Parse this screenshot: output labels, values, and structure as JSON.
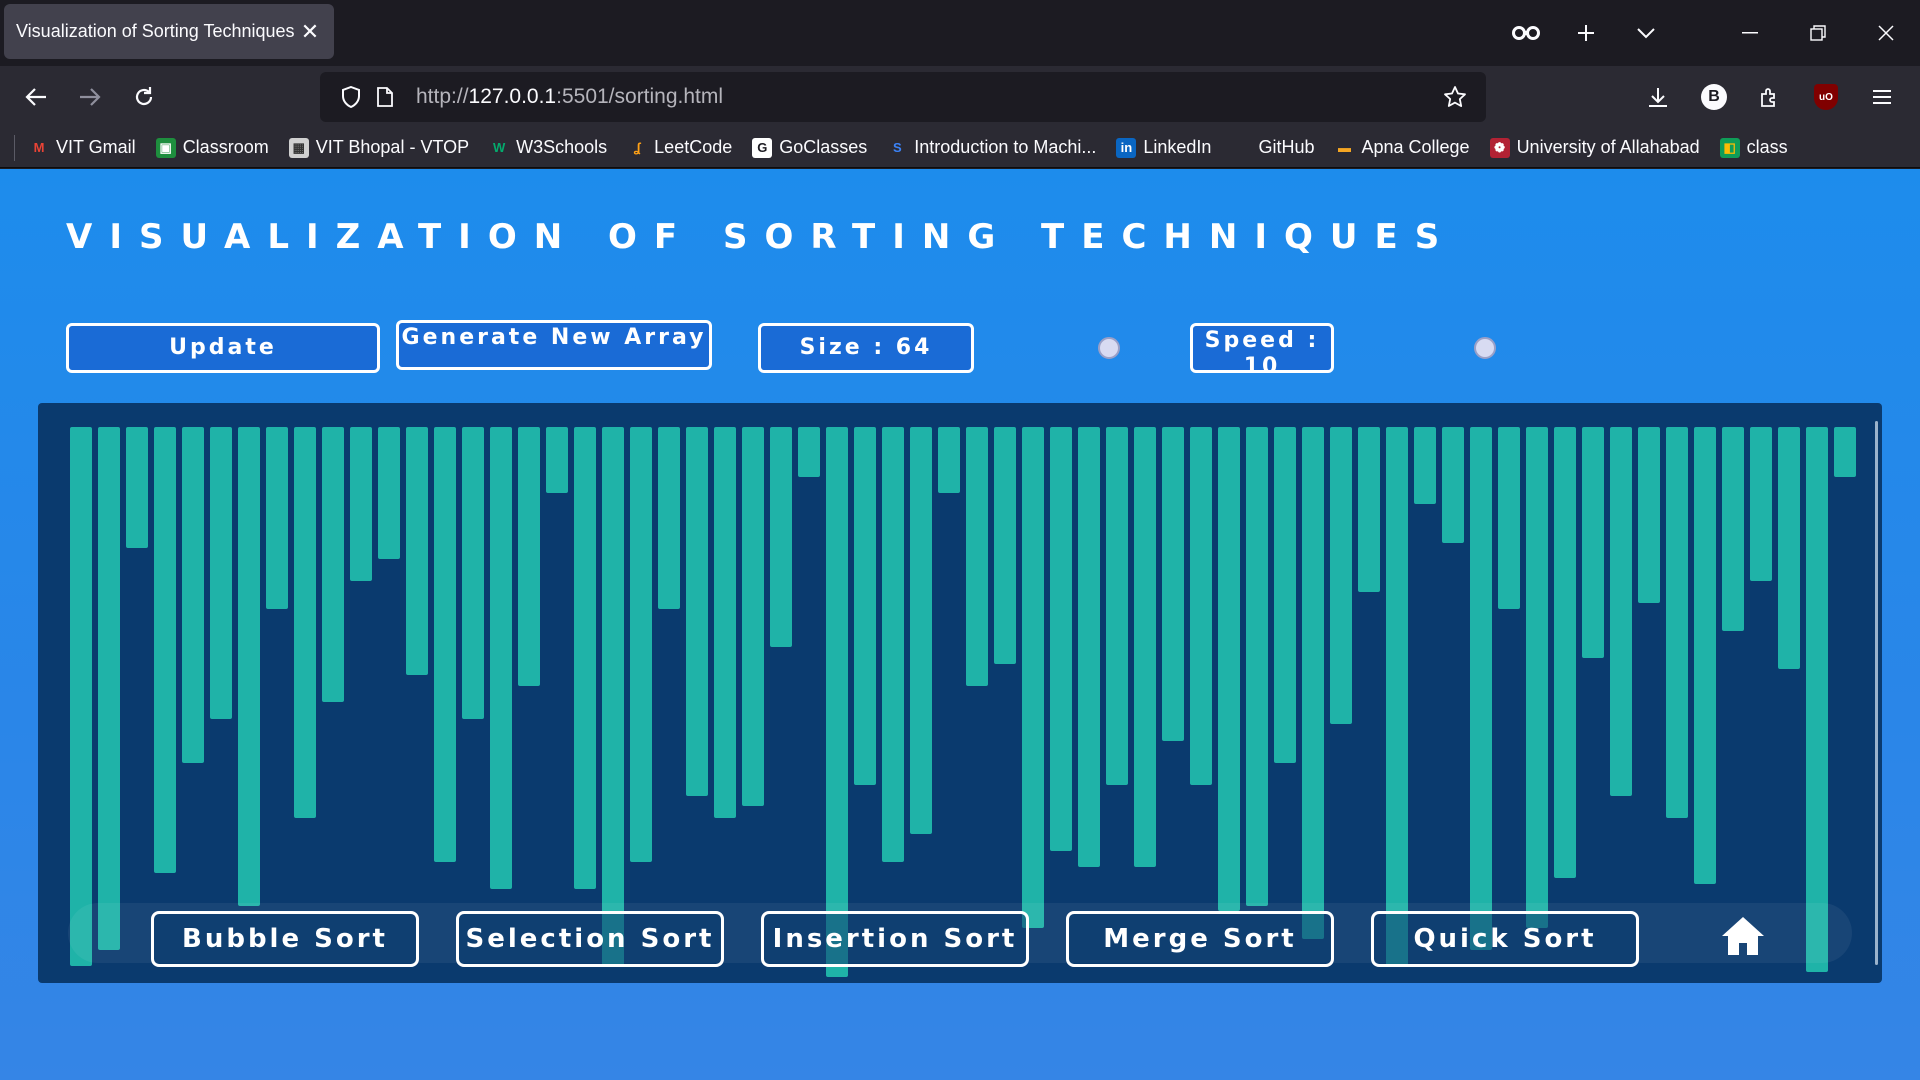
{
  "browser": {
    "tab_title": "Visualization of Sorting Techniques",
    "tab_close": "✕",
    "url_prefix": "http://",
    "url_host": "127.0.0.1",
    "url_rest": ":5501/sorting.html",
    "profile_initial": "B",
    "ublock_label": "uO"
  },
  "bookmarks": [
    {
      "label": "VIT Gmail",
      "icon_glyph": "M",
      "icon_color": "#ea4335",
      "icon_bg": "transparent"
    },
    {
      "label": "Classroom",
      "icon_glyph": "▣",
      "icon_color": "#ffffff",
      "icon_bg": "#1e8e3e"
    },
    {
      "label": "VIT Bhopal - VTOP",
      "icon_glyph": "▦",
      "icon_color": "#333333",
      "icon_bg": "#d0d0d0"
    },
    {
      "label": "W3Schools",
      "icon_glyph": "W",
      "icon_color": "#04aa6d",
      "icon_bg": "transparent"
    },
    {
      "label": "LeetCode",
      "icon_glyph": "ʆ",
      "icon_color": "#ffa116",
      "icon_bg": "transparent"
    },
    {
      "label": "GoClasses",
      "icon_glyph": "G",
      "icon_color": "#1c1b22",
      "icon_bg": "#ffffff"
    },
    {
      "label": "Introduction to Machi...",
      "icon_glyph": "S",
      "icon_color": "#3b82f6",
      "icon_bg": "transparent"
    },
    {
      "label": "LinkedIn",
      "icon_glyph": "in",
      "icon_color": "#ffffff",
      "icon_bg": "#0a66c2"
    },
    {
      "label": "GitHub",
      "icon_glyph": "",
      "icon_color": "#2b2a33",
      "icon_bg": "transparent"
    },
    {
      "label": "Apna College",
      "icon_glyph": "▬",
      "icon_color": "#f5a623",
      "icon_bg": "transparent"
    },
    {
      "label": "University of Allahabad",
      "icon_glyph": "❁",
      "icon_color": "#ffffff",
      "icon_bg": "#b22234"
    },
    {
      "label": "class",
      "icon_glyph": "◧",
      "icon_color": "#fbbc04",
      "icon_bg": "#0f9d58"
    }
  ],
  "page": {
    "title": "VISUALIZATION OF SORTING TECHNIQUES",
    "controls": {
      "update": "Update",
      "generate": "Generate New Array",
      "size": "Size : 64",
      "speed": "Speed : 10"
    },
    "sort_buttons": [
      "Bubble Sort",
      "Selection Sort",
      "Insertion Sort",
      "Merge Sort",
      "Quick Sort"
    ],
    "bar_color": "#1fb3a8",
    "bar_heights_relative": [
      0.98,
      0.95,
      0.22,
      0.81,
      0.61,
      0.53,
      0.87,
      0.33,
      0.71,
      0.5,
      0.28,
      0.24,
      0.45,
      0.79,
      0.53,
      0.84,
      0.47,
      0.12,
      0.84,
      0.98,
      0.79,
      0.33,
      0.67,
      0.71,
      0.69,
      0.4,
      0.09,
      1.0,
      0.65,
      0.79,
      0.74,
      0.12,
      0.47,
      0.43,
      0.91,
      0.77,
      0.8,
      0.65,
      0.8,
      0.57,
      0.65,
      0.88,
      0.87,
      0.61,
      0.93,
      0.54,
      0.3,
      0.98,
      0.14,
      0.21,
      0.95,
      0.33,
      0.91,
      0.82,
      0.42,
      0.67,
      0.32,
      0.71,
      0.83,
      0.37,
      0.28,
      0.44,
      0.99,
      0.09
    ]
  }
}
